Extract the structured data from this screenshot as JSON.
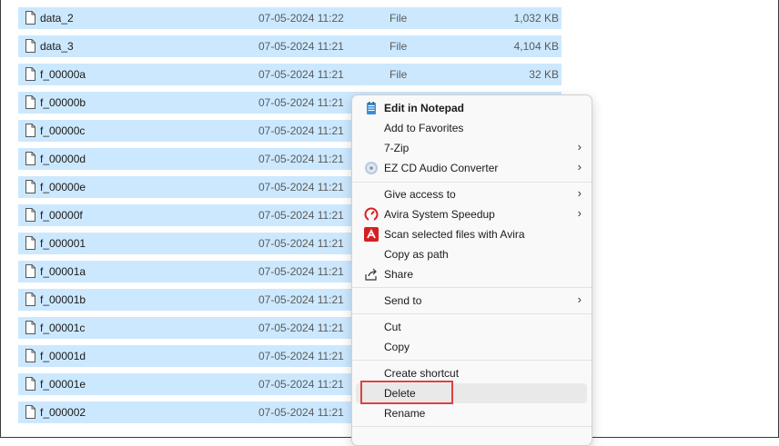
{
  "files": [
    {
      "name": "data_2",
      "date": "07-05-2024 11:22",
      "type": "File",
      "size": "1,032 KB"
    },
    {
      "name": "data_3",
      "date": "07-05-2024 11:21",
      "type": "File",
      "size": "4,104 KB"
    },
    {
      "name": "f_00000a",
      "date": "07-05-2024 11:21",
      "type": "File",
      "size": "32 KB"
    },
    {
      "name": "f_00000b",
      "date": "07-05-2024 11:21",
      "type": "",
      "size": ""
    },
    {
      "name": "f_00000c",
      "date": "07-05-2024 11:21",
      "type": "",
      "size": ""
    },
    {
      "name": "f_00000d",
      "date": "07-05-2024 11:21",
      "type": "",
      "size": ""
    },
    {
      "name": "f_00000e",
      "date": "07-05-2024 11:21",
      "type": "",
      "size": ""
    },
    {
      "name": "f_00000f",
      "date": "07-05-2024 11:21",
      "type": "",
      "size": ""
    },
    {
      "name": "f_000001",
      "date": "07-05-2024 11:21",
      "type": "",
      "size": ""
    },
    {
      "name": "f_00001a",
      "date": "07-05-2024 11:21",
      "type": "",
      "size": ""
    },
    {
      "name": "f_00001b",
      "date": "07-05-2024 11:21",
      "type": "",
      "size": ""
    },
    {
      "name": "f_00001c",
      "date": "07-05-2024 11:21",
      "type": "",
      "size": ""
    },
    {
      "name": "f_00001d",
      "date": "07-05-2024 11:21",
      "type": "",
      "size": ""
    },
    {
      "name": "f_00001e",
      "date": "07-05-2024 11:21",
      "type": "",
      "size": ""
    },
    {
      "name": "f_000002",
      "date": "07-05-2024 11:21",
      "type": "",
      "size": ""
    }
  ],
  "menu": {
    "edit_notepad": "Edit in Notepad",
    "add_favorites": "Add to Favorites",
    "seven_zip": "7-Zip",
    "ez_cd": "EZ CD Audio Converter",
    "give_access": "Give access to",
    "avira_speedup": "Avira System Speedup",
    "avira_scan": "Scan selected files with Avira",
    "copy_path": "Copy as path",
    "share": "Share",
    "send_to": "Send to",
    "cut": "Cut",
    "copy": "Copy",
    "create_shortcut": "Create shortcut",
    "delete": "Delete",
    "rename": "Rename",
    "arrow": "›"
  },
  "colors": {
    "selection": "#cce8ff",
    "avira_red": "#d62020",
    "highlight_border": "#e04040"
  },
  "icons": {
    "notepad": "notepad-icon",
    "ez_cd": "cd-icon",
    "avira_speedup": "speedometer-icon",
    "avira_scan": "avira-umbrella-icon",
    "share": "share-icon",
    "file": "file-icon"
  }
}
